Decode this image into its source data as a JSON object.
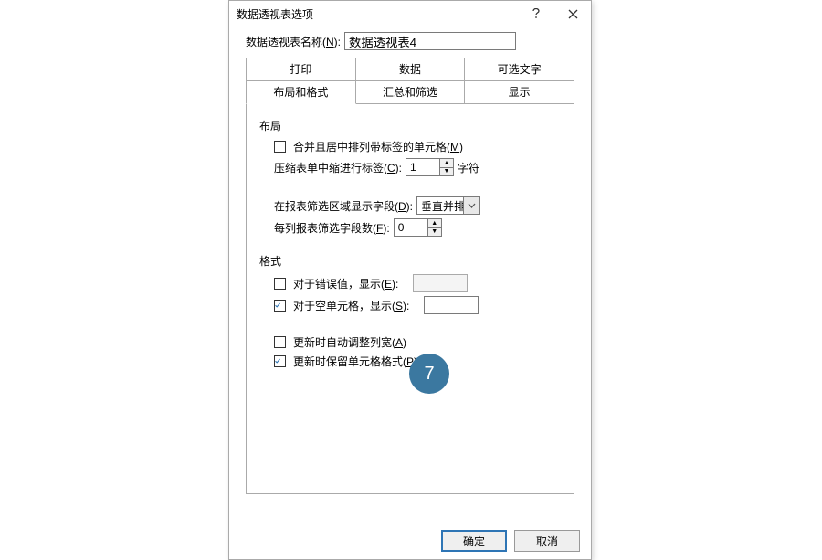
{
  "dialog": {
    "title": "数据透视表选项",
    "name_label_pre": "数据透视表名称(",
    "name_label_ul": "N",
    "name_label_post": "):",
    "name_value": "数据透视表4"
  },
  "tabs": {
    "row1": [
      "打印",
      "数据",
      "可选文字"
    ],
    "row2": [
      "布局和格式",
      "汇总和筛选",
      "显示"
    ],
    "active": "布局和格式"
  },
  "layout_group": {
    "title": "布局",
    "merge_pre": "合并且居中排列带标签的单元格(",
    "merge_ul": "M",
    "merge_post": ")",
    "merge_checked": false,
    "compact_pre": "压缩表单中缩进行标签(",
    "compact_ul": "C",
    "compact_post": "):",
    "compact_value": "1",
    "compact_suffix": "字符",
    "filter_area_pre": "在报表筛选区域显示字段(",
    "filter_area_ul": "D",
    "filter_area_post": "):",
    "filter_area_value": "垂直并排",
    "fields_per_col_pre": "每列报表筛选字段数(",
    "fields_per_col_ul": "F",
    "fields_per_col_post": "):",
    "fields_per_col_value": "0"
  },
  "format_group": {
    "title": "格式",
    "error_pre": "对于错误值，显示(",
    "error_ul": "E",
    "error_post": "):",
    "error_checked": false,
    "empty_pre": "对于空单元格，显示(",
    "empty_ul": "S",
    "empty_post": "):",
    "empty_checked": true,
    "autofit_pre": "更新时自动调整列宽(",
    "autofit_ul": "A",
    "autofit_post": ")",
    "autofit_checked": false,
    "preserve_pre": "更新时保留单元格格式(",
    "preserve_ul": "P",
    "preserve_post": ")",
    "preserve_checked": true
  },
  "annotation": {
    "number": "7"
  },
  "buttons": {
    "ok": "确定",
    "cancel": "取消"
  }
}
